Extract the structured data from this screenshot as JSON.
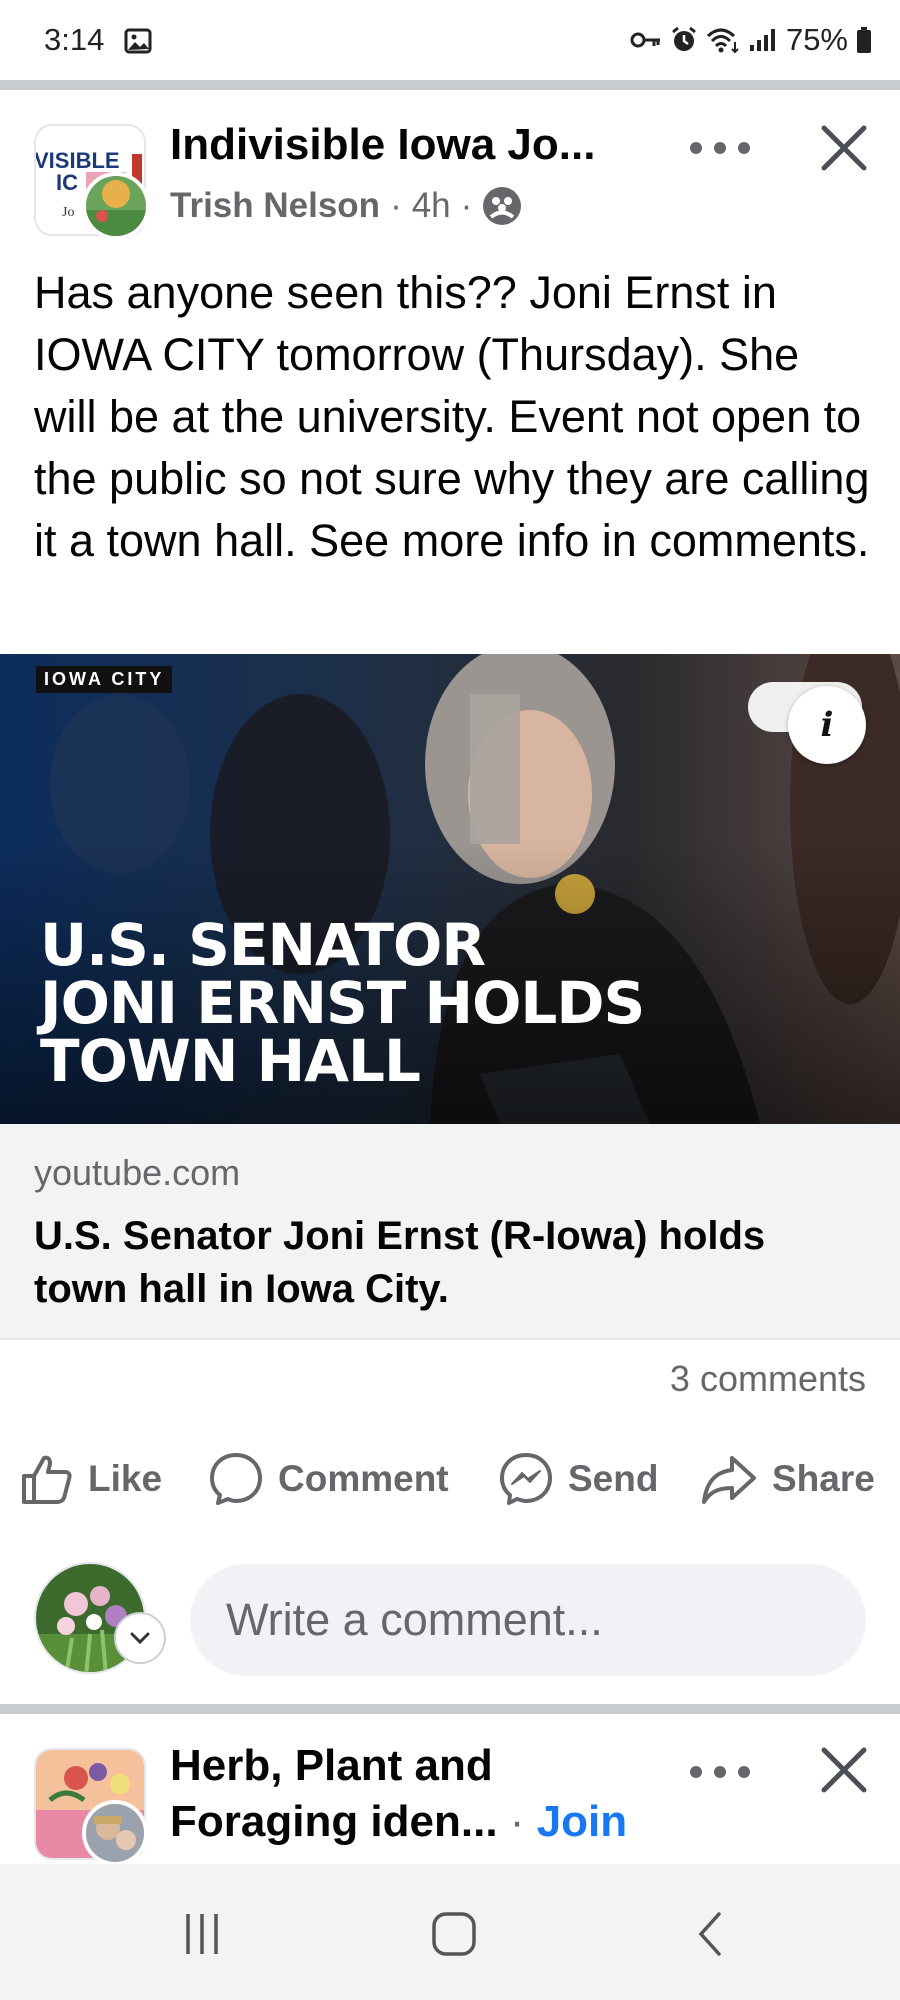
{
  "status_bar": {
    "time": "3:14",
    "battery": "75%",
    "icons": [
      "photo-icon",
      "key-icon",
      "alarm-icon",
      "wifi-icon",
      "signal-icon",
      "battery-icon"
    ]
  },
  "post": {
    "group_name": "Indivisible Iowa Jo...",
    "author": "Trish Nelson",
    "time": "4h",
    "separator": "·",
    "body": "Has anyone seen this?? Joni Ernst in IOWA CITY tomorrow (Thursday). She will be at the university. Event not open to the public so not sure why they are calling it a town hall. See more info in comments.",
    "link": {
      "image_tag": "IOWA CITY",
      "image_headline": [
        "U.S. SENATOR",
        "JONI ERNST HOLDS",
        "TOWN HALL"
      ],
      "info_glyph": "i",
      "domain": "youtube.com",
      "title": "U.S. Senator Joni Ernst (R-Iowa) holds town hall in Iowa City."
    },
    "comments_count": "3 comments",
    "actions": {
      "like": "Like",
      "comment": "Comment",
      "send": "Send",
      "share": "Share"
    },
    "comment_placeholder": "Write a comment..."
  },
  "next_post": {
    "title_line1": "Herb, Plant and",
    "title_line2": "Foraging iden...",
    "separator": "·",
    "join": "Join"
  },
  "colors": {
    "link_blue": "#1877f2",
    "secondary_text": "#65676b",
    "divider": "#c9ccd1"
  }
}
